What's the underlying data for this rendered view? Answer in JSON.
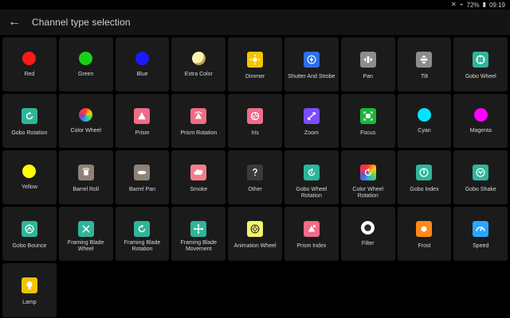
{
  "status": {
    "icons": [
      "mute-icon",
      "wifi-icon",
      "battery-icon"
    ],
    "battery": "72%",
    "time": "09:19"
  },
  "appbar": {
    "title": "Channel type selection"
  },
  "tiles": [
    {
      "label": "Red"
    },
    {
      "label": "Green"
    },
    {
      "label": "Blue"
    },
    {
      "label": "Extra Color"
    },
    {
      "label": "Dimmer"
    },
    {
      "label": "Shutter And Strobe"
    },
    {
      "label": "Pan"
    },
    {
      "label": "Tilt"
    },
    {
      "label": "Gobo Wheel"
    },
    {
      "label": "Gobo Rotation"
    },
    {
      "label": "Color Wheel"
    },
    {
      "label": "Prism"
    },
    {
      "label": "Prism Rotation"
    },
    {
      "label": "Iris"
    },
    {
      "label": "Zoom"
    },
    {
      "label": "Focus"
    },
    {
      "label": "Cyan"
    },
    {
      "label": "Magenta"
    },
    {
      "label": "Yellow"
    },
    {
      "label": "Barrel Roll"
    },
    {
      "label": "Barrel Pan"
    },
    {
      "label": "Smoke"
    },
    {
      "label": "Other"
    },
    {
      "label": "Gobo Wheel Rotation"
    },
    {
      "label": "Color Wheel Rotation"
    },
    {
      "label": "Gobo Index"
    },
    {
      "label": "Gobo Shake"
    },
    {
      "label": "Gobo Bounce"
    },
    {
      "label": "Framing Blade Wheel"
    },
    {
      "label": "Framing Blade Rotation"
    },
    {
      "label": "Framing Blade Movement"
    },
    {
      "label": "Animation Wheel"
    },
    {
      "label": "Prism Index"
    },
    {
      "label": "Filter"
    },
    {
      "label": "Frost"
    },
    {
      "label": "Speed"
    },
    {
      "label": "Lamp"
    }
  ],
  "colors": {
    "red": "#ff1a1a",
    "green": "#18d118",
    "blue": "#1a1aff",
    "cyan": "#00e5ff",
    "magenta": "#ff00ff",
    "yellow": "#ffff00",
    "pink": "#f06c87",
    "teal": "#2fb59b",
    "orange": "#ff8a1a",
    "violet": "#7c4dff",
    "blueBolt": "#2d6fe8",
    "lamp": "#f2c400",
    "slate": "#8c8c8c",
    "pinkLight": "#f37e8d"
  }
}
